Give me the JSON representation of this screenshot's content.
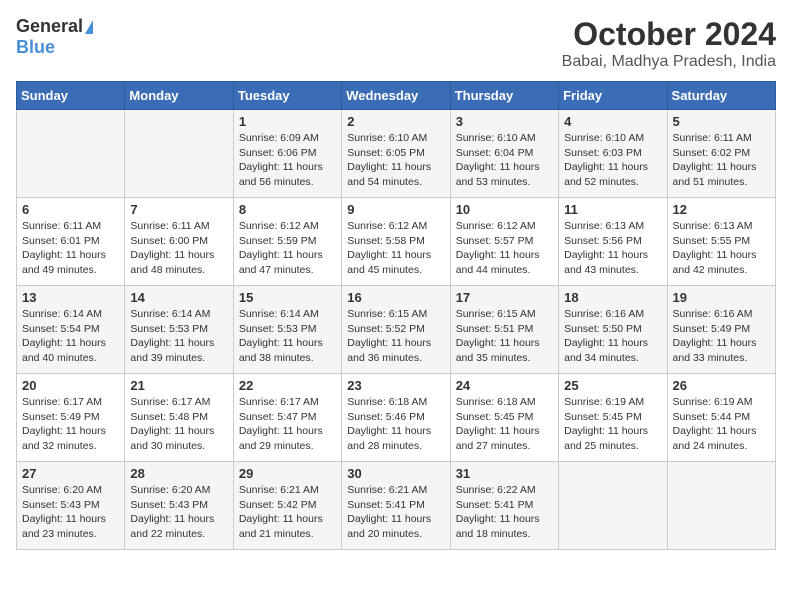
{
  "logo": {
    "general": "General",
    "blue": "Blue"
  },
  "title": "October 2024",
  "subtitle": "Babai, Madhya Pradesh, India",
  "days_of_week": [
    "Sunday",
    "Monday",
    "Tuesday",
    "Wednesday",
    "Thursday",
    "Friday",
    "Saturday"
  ],
  "weeks": [
    [
      {
        "day": "",
        "sunrise": "",
        "sunset": "",
        "daylight": ""
      },
      {
        "day": "",
        "sunrise": "",
        "sunset": "",
        "daylight": ""
      },
      {
        "day": "1",
        "sunrise": "Sunrise: 6:09 AM",
        "sunset": "Sunset: 6:06 PM",
        "daylight": "Daylight: 11 hours and 56 minutes."
      },
      {
        "day": "2",
        "sunrise": "Sunrise: 6:10 AM",
        "sunset": "Sunset: 6:05 PM",
        "daylight": "Daylight: 11 hours and 54 minutes."
      },
      {
        "day": "3",
        "sunrise": "Sunrise: 6:10 AM",
        "sunset": "Sunset: 6:04 PM",
        "daylight": "Daylight: 11 hours and 53 minutes."
      },
      {
        "day": "4",
        "sunrise": "Sunrise: 6:10 AM",
        "sunset": "Sunset: 6:03 PM",
        "daylight": "Daylight: 11 hours and 52 minutes."
      },
      {
        "day": "5",
        "sunrise": "Sunrise: 6:11 AM",
        "sunset": "Sunset: 6:02 PM",
        "daylight": "Daylight: 11 hours and 51 minutes."
      }
    ],
    [
      {
        "day": "6",
        "sunrise": "Sunrise: 6:11 AM",
        "sunset": "Sunset: 6:01 PM",
        "daylight": "Daylight: 11 hours and 49 minutes."
      },
      {
        "day": "7",
        "sunrise": "Sunrise: 6:11 AM",
        "sunset": "Sunset: 6:00 PM",
        "daylight": "Daylight: 11 hours and 48 minutes."
      },
      {
        "day": "8",
        "sunrise": "Sunrise: 6:12 AM",
        "sunset": "Sunset: 5:59 PM",
        "daylight": "Daylight: 11 hours and 47 minutes."
      },
      {
        "day": "9",
        "sunrise": "Sunrise: 6:12 AM",
        "sunset": "Sunset: 5:58 PM",
        "daylight": "Daylight: 11 hours and 45 minutes."
      },
      {
        "day": "10",
        "sunrise": "Sunrise: 6:12 AM",
        "sunset": "Sunset: 5:57 PM",
        "daylight": "Daylight: 11 hours and 44 minutes."
      },
      {
        "day": "11",
        "sunrise": "Sunrise: 6:13 AM",
        "sunset": "Sunset: 5:56 PM",
        "daylight": "Daylight: 11 hours and 43 minutes."
      },
      {
        "day": "12",
        "sunrise": "Sunrise: 6:13 AM",
        "sunset": "Sunset: 5:55 PM",
        "daylight": "Daylight: 11 hours and 42 minutes."
      }
    ],
    [
      {
        "day": "13",
        "sunrise": "Sunrise: 6:14 AM",
        "sunset": "Sunset: 5:54 PM",
        "daylight": "Daylight: 11 hours and 40 minutes."
      },
      {
        "day": "14",
        "sunrise": "Sunrise: 6:14 AM",
        "sunset": "Sunset: 5:53 PM",
        "daylight": "Daylight: 11 hours and 39 minutes."
      },
      {
        "day": "15",
        "sunrise": "Sunrise: 6:14 AM",
        "sunset": "Sunset: 5:53 PM",
        "daylight": "Daylight: 11 hours and 38 minutes."
      },
      {
        "day": "16",
        "sunrise": "Sunrise: 6:15 AM",
        "sunset": "Sunset: 5:52 PM",
        "daylight": "Daylight: 11 hours and 36 minutes."
      },
      {
        "day": "17",
        "sunrise": "Sunrise: 6:15 AM",
        "sunset": "Sunset: 5:51 PM",
        "daylight": "Daylight: 11 hours and 35 minutes."
      },
      {
        "day": "18",
        "sunrise": "Sunrise: 6:16 AM",
        "sunset": "Sunset: 5:50 PM",
        "daylight": "Daylight: 11 hours and 34 minutes."
      },
      {
        "day": "19",
        "sunrise": "Sunrise: 6:16 AM",
        "sunset": "Sunset: 5:49 PM",
        "daylight": "Daylight: 11 hours and 33 minutes."
      }
    ],
    [
      {
        "day": "20",
        "sunrise": "Sunrise: 6:17 AM",
        "sunset": "Sunset: 5:49 PM",
        "daylight": "Daylight: 11 hours and 32 minutes."
      },
      {
        "day": "21",
        "sunrise": "Sunrise: 6:17 AM",
        "sunset": "Sunset: 5:48 PM",
        "daylight": "Daylight: 11 hours and 30 minutes."
      },
      {
        "day": "22",
        "sunrise": "Sunrise: 6:17 AM",
        "sunset": "Sunset: 5:47 PM",
        "daylight": "Daylight: 11 hours and 29 minutes."
      },
      {
        "day": "23",
        "sunrise": "Sunrise: 6:18 AM",
        "sunset": "Sunset: 5:46 PM",
        "daylight": "Daylight: 11 hours and 28 minutes."
      },
      {
        "day": "24",
        "sunrise": "Sunrise: 6:18 AM",
        "sunset": "Sunset: 5:45 PM",
        "daylight": "Daylight: 11 hours and 27 minutes."
      },
      {
        "day": "25",
        "sunrise": "Sunrise: 6:19 AM",
        "sunset": "Sunset: 5:45 PM",
        "daylight": "Daylight: 11 hours and 25 minutes."
      },
      {
        "day": "26",
        "sunrise": "Sunrise: 6:19 AM",
        "sunset": "Sunset: 5:44 PM",
        "daylight": "Daylight: 11 hours and 24 minutes."
      }
    ],
    [
      {
        "day": "27",
        "sunrise": "Sunrise: 6:20 AM",
        "sunset": "Sunset: 5:43 PM",
        "daylight": "Daylight: 11 hours and 23 minutes."
      },
      {
        "day": "28",
        "sunrise": "Sunrise: 6:20 AM",
        "sunset": "Sunset: 5:43 PM",
        "daylight": "Daylight: 11 hours and 22 minutes."
      },
      {
        "day": "29",
        "sunrise": "Sunrise: 6:21 AM",
        "sunset": "Sunset: 5:42 PM",
        "daylight": "Daylight: 11 hours and 21 minutes."
      },
      {
        "day": "30",
        "sunrise": "Sunrise: 6:21 AM",
        "sunset": "Sunset: 5:41 PM",
        "daylight": "Daylight: 11 hours and 20 minutes."
      },
      {
        "day": "31",
        "sunrise": "Sunrise: 6:22 AM",
        "sunset": "Sunset: 5:41 PM",
        "daylight": "Daylight: 11 hours and 18 minutes."
      },
      {
        "day": "",
        "sunrise": "",
        "sunset": "",
        "daylight": ""
      },
      {
        "day": "",
        "sunrise": "",
        "sunset": "",
        "daylight": ""
      }
    ]
  ]
}
